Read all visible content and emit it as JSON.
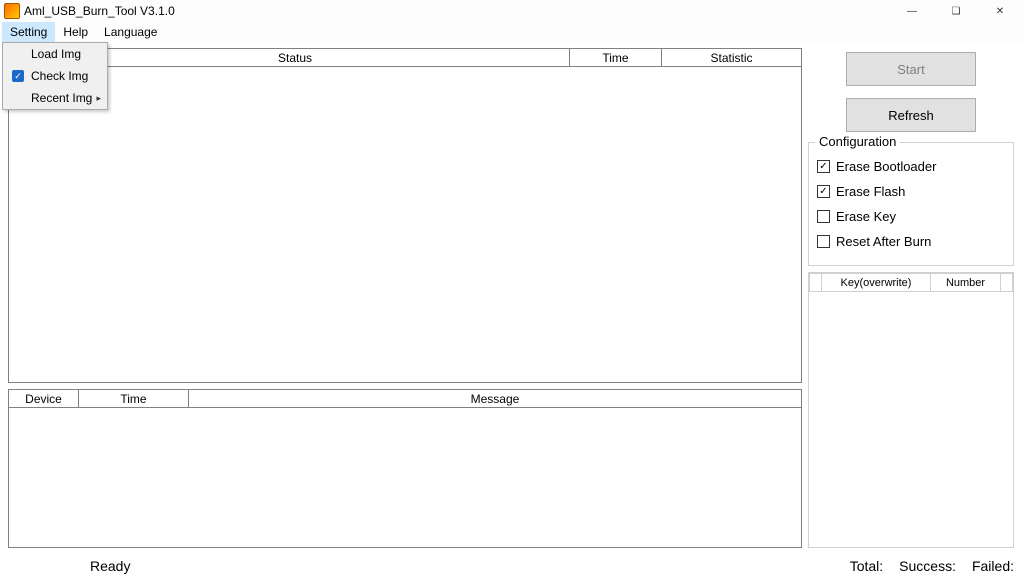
{
  "window": {
    "title": "Aml_USB_Burn_Tool V3.1.0"
  },
  "menubar": {
    "setting": "Setting",
    "help": "Help",
    "language": "Language"
  },
  "setting_menu": {
    "load_img": "Load Img",
    "check_img": "Check Img",
    "recent_img": "Recent Img",
    "check_img_checked": true
  },
  "top_table": {
    "col_status": "Status",
    "col_time": "Time",
    "col_statistic": "Statistic"
  },
  "bottom_table": {
    "col_device": "Device",
    "col_time": "Time",
    "col_message": "Message"
  },
  "buttons": {
    "start": "Start",
    "refresh": "Refresh"
  },
  "config": {
    "legend": "Configuration",
    "erase_bootloader": {
      "label": "Erase Bootloader",
      "checked": true
    },
    "erase_flash": {
      "label": "Erase Flash",
      "checked": true
    },
    "erase_key": {
      "label": "Erase Key",
      "checked": false
    },
    "reset_after_burn": {
      "label": "Reset After Burn",
      "checked": false
    }
  },
  "keys_table": {
    "col_key": "Key(overwrite)",
    "col_number": "Number"
  },
  "statusbar": {
    "ready": "Ready",
    "total": "Total:",
    "success": "Success:",
    "failed": "Failed:"
  }
}
